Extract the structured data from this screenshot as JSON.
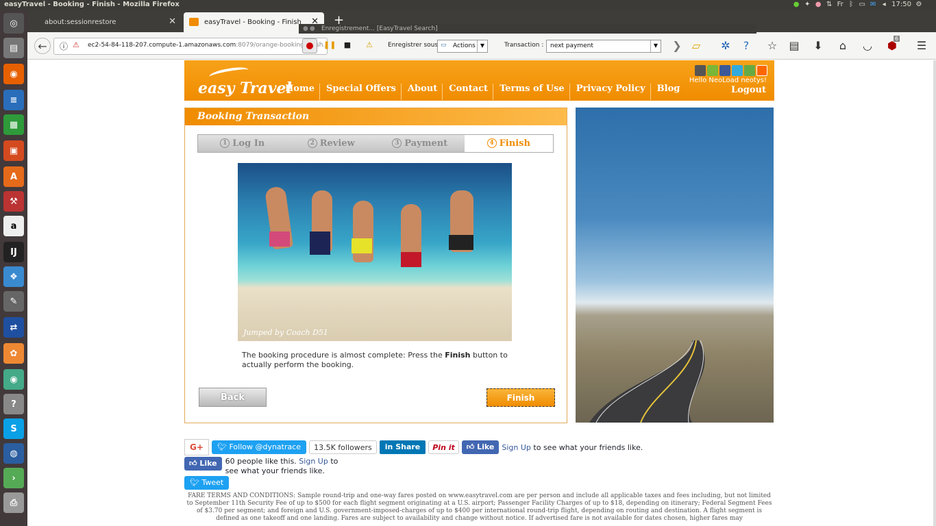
{
  "os": {
    "window_title": "easyTravel - Booking - Finish - Mozilla Firefox",
    "tray": {
      "lang": "Fr",
      "time": "17:50"
    }
  },
  "browser": {
    "tabs": [
      {
        "label": "about:sessionrestore"
      },
      {
        "label": "easyTravel - Booking - Finish"
      }
    ],
    "new_tab": "+",
    "url_host": "ec2-54-84-118-207.compute-1.amazonaws.com",
    "url_rest": ":8079/orange-booking-finish.j",
    "ublock_count": "6"
  },
  "neoload": {
    "title": "Enregistrement... [EasyTravel Search]",
    "save_label": "Enregistrer sous :",
    "save_value": "Actions",
    "transaction_label": "Transaction :",
    "transaction_value": "next payment"
  },
  "site": {
    "logo_text": "easy Travel",
    "menu": [
      "Home",
      "Special Offers",
      "About",
      "Contact",
      "Terms of Use",
      "Privacy Policy",
      "Blog"
    ],
    "hello": "Hello NeoLoad neotys!",
    "logout": "Logout"
  },
  "booking": {
    "title": "Booking Transaction",
    "steps": [
      {
        "num": "1",
        "label": "Log In"
      },
      {
        "num": "2",
        "label": "Review"
      },
      {
        "num": "3",
        "label": "Payment"
      },
      {
        "num": "4",
        "label": "Finish"
      }
    ],
    "photo_credit": "Jumped by Coach D51",
    "text_before": "The booking procedure is almost complete: Press the ",
    "text_bold": "Finish",
    "text_after": " button to actually perform the booking.",
    "back_label": "Back",
    "finish_label": "Finish"
  },
  "social": {
    "gplus": "G+",
    "twitter_follow": "Follow @dynatrace",
    "twitter_count": "13.5K followers",
    "linkedin": "Share",
    "pinterest": "Pin it",
    "fb_like": "Like",
    "fb_signup": "Sign Up",
    "fb_rest": " to see what your friends like.",
    "fb2_like": "Like",
    "fb2_count": "60 people like this. ",
    "fb2_signup": "Sign Up",
    "fb2_rest": " to see what your friends like.",
    "tweet": "Tweet"
  },
  "terms": "FARE TERMS AND CONDITIONS: Sample round-trip and one-way fares posted on www.easytravel.com are per person and include all applicable taxes and fees including, but not limited to September 11th Security Fee of up to $500 for each flight segment originating at a U.S. airport; Passenger Facility Charges of up to $18, depending on itinerary; Federal Segment Fees of $3.70 per segment; and foreign and U.S. government-imposed-charges of up to $400 per international round-trip flight, depending on routing and destination. A flight segment is defined as one takeoff and one landing. Fares are subject to availability and change without notice. If advertised fare is not available for dates chosen, higher fares may"
}
